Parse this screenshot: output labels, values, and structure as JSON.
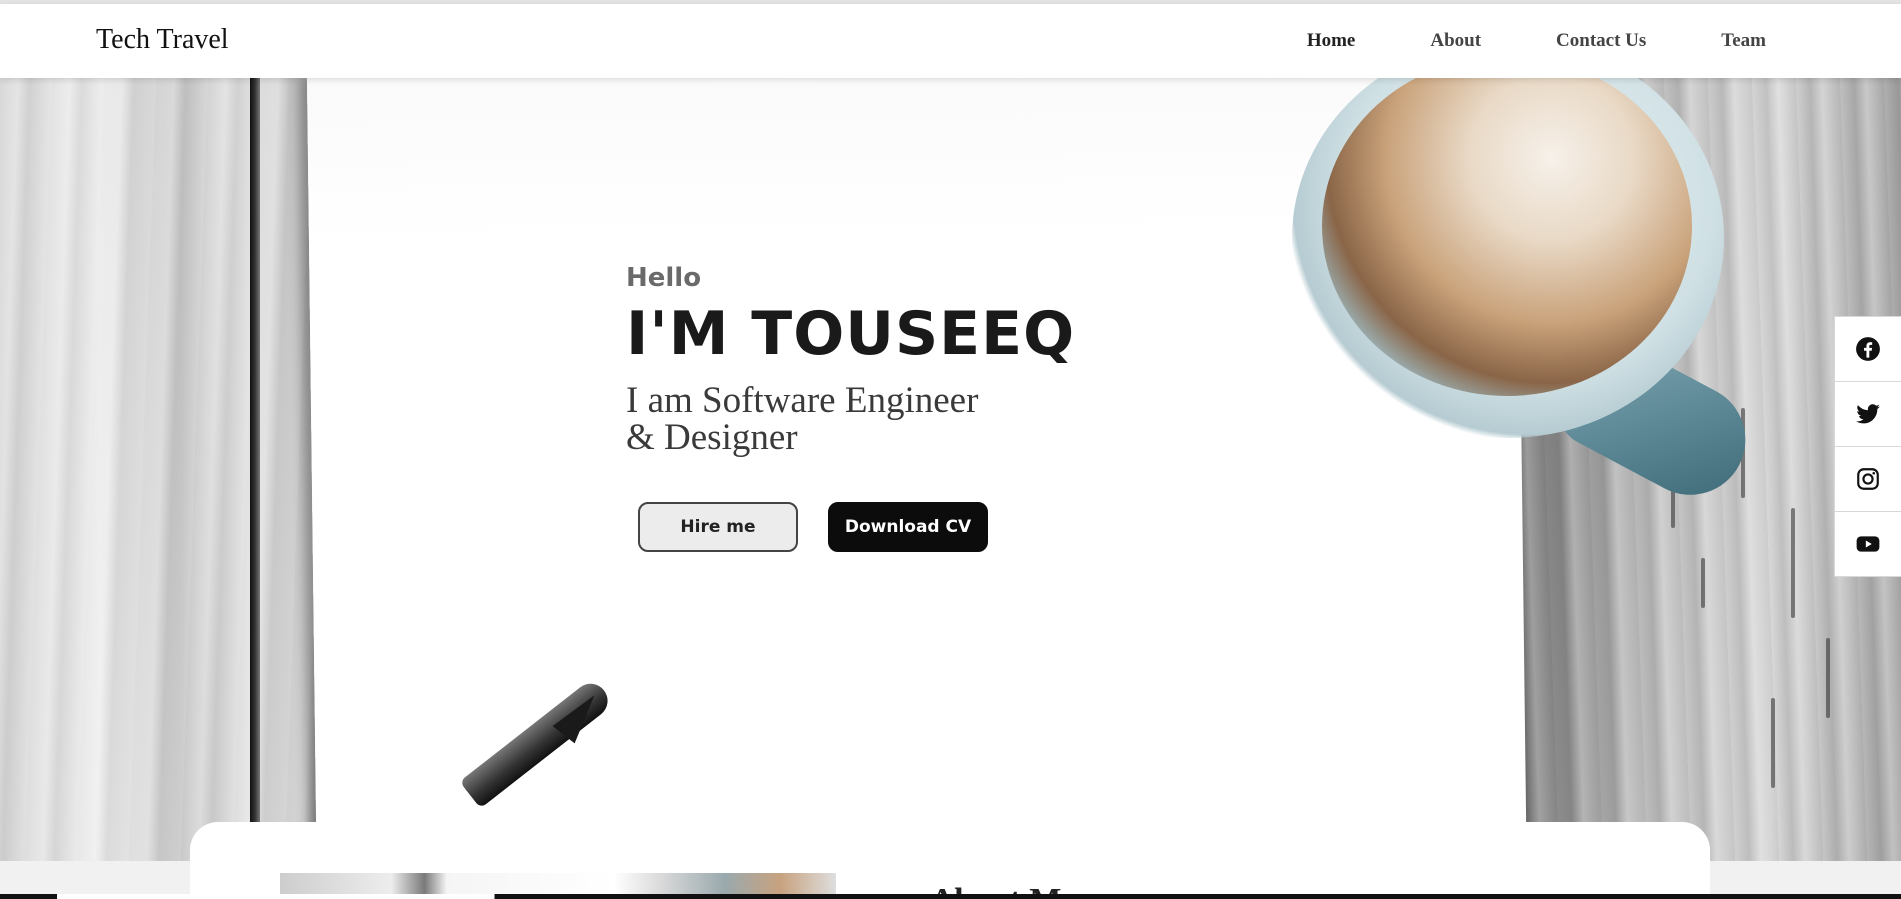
{
  "navbar": {
    "brand": "Tech Travel",
    "links": [
      {
        "label": "Home"
      },
      {
        "label": "About"
      },
      {
        "label": "Contact Us"
      },
      {
        "label": "Team"
      }
    ]
  },
  "hero": {
    "greeting": "Hello",
    "name": "I'M TOUSEEQ",
    "role_line1": "I am Software Engineer",
    "role_line2": "& Designer",
    "hire_button": "Hire me",
    "download_button": "Download CV"
  },
  "social": {
    "icons": [
      "facebook-icon",
      "twitter-icon",
      "instagram-icon",
      "youtube-icon"
    ]
  },
  "about": {
    "title": "About Me"
  },
  "colors": {
    "accent": "#0c0c0c",
    "page_bg": "#f1f1f1",
    "nav_text": "#444444"
  }
}
